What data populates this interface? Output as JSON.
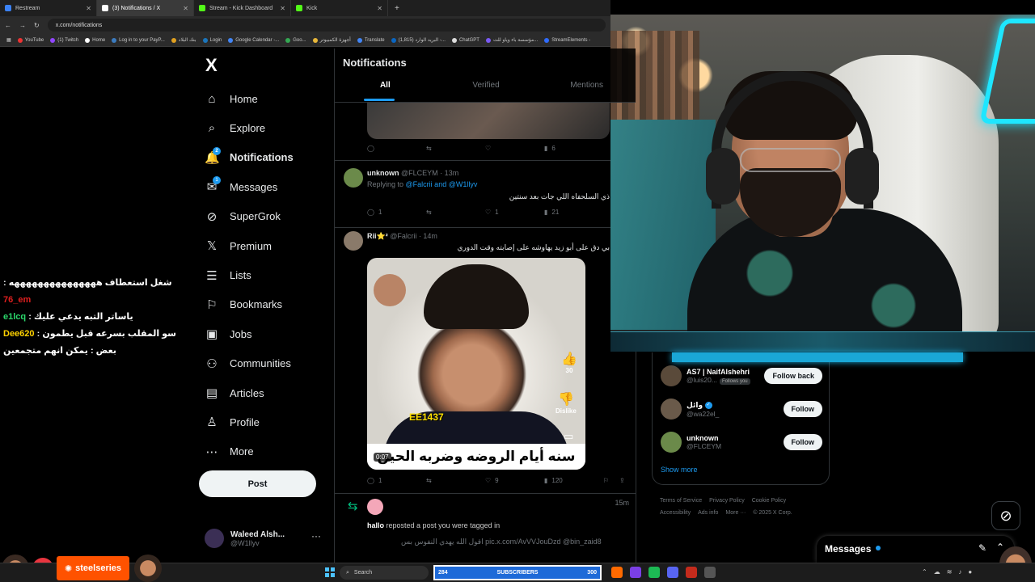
{
  "browser": {
    "tabs": [
      {
        "title": "Restream",
        "color": "#3b82f6"
      },
      {
        "title": "(3) Notifications / X",
        "color": "#ffffff"
      },
      {
        "title": "Stream - Kick Dashboard",
        "color": "#53fc18"
      },
      {
        "title": "Kick",
        "color": "#53fc18"
      }
    ],
    "url": "x.com/notifications",
    "bookmarks": [
      "YouTube",
      "(1) Twitch",
      "Home",
      "Log in to your PayP...",
      "بنك البلاد",
      "Login",
      "Google Calendar -...",
      "Goo...",
      "أجهزة الكمبيوتر",
      "Translate",
      "(1,815) البريد الوارد -...",
      "ChatGPT",
      "مؤسسة باء وياو للت...",
      "StreamElements -"
    ]
  },
  "chat": [
    {
      "user": "76_em",
      "msg": "شغل استعطاف هههههههههههههههه"
    },
    {
      "user": "e1lcq",
      "msg": "ياساتر التبه يدعي عليك"
    },
    {
      "user": "Dee620",
      "msg": "سو المقلب بسرعه قبل يطمون بعض : يمكن انهم متجمعين"
    }
  ],
  "sidebar": {
    "logo": "X",
    "items": [
      {
        "label": "Home",
        "icon": "⌂",
        "badge": ""
      },
      {
        "label": "Explore",
        "icon": "⌕",
        "badge": ""
      },
      {
        "label": "Notifications",
        "icon": "🔔",
        "badge": "2"
      },
      {
        "label": "Messages",
        "icon": "✉",
        "badge": "1"
      },
      {
        "label": "SuperGrok",
        "icon": "⊘",
        "badge": ""
      },
      {
        "label": "Premium",
        "icon": "𝕏",
        "badge": ""
      },
      {
        "label": "Lists",
        "icon": "☰",
        "badge": ""
      },
      {
        "label": "Bookmarks",
        "icon": "⚐",
        "badge": ""
      },
      {
        "label": "Jobs",
        "icon": "▣",
        "badge": ""
      },
      {
        "label": "Communities",
        "icon": "⚇",
        "badge": ""
      },
      {
        "label": "Articles",
        "icon": "▤",
        "badge": ""
      },
      {
        "label": "Profile",
        "icon": "♙",
        "badge": ""
      },
      {
        "label": "More",
        "icon": "⋯",
        "badge": ""
      }
    ],
    "post_label": "Post",
    "account": {
      "name": "Waleed Alsh...",
      "handle": "@W1llyv"
    }
  },
  "feed": {
    "title": "Notifications",
    "tabs": [
      "All",
      "Verified",
      "Mentions"
    ],
    "top_actions": {
      "views": "6"
    },
    "post1": {
      "name": "unknown",
      "handle": "@FLCEYM",
      "time": "· 13m",
      "replying_prefix": "Replying to",
      "replying_to": "@Falcrii and @W1llyv",
      "text": "ذي السلحفاه اللي جات بعد سنتين",
      "replies": "1",
      "likes": "1",
      "views": "21"
    },
    "post2": {
      "name": "Rii⭐²",
      "handle": "@Falcrii",
      "time": "· 14m",
      "text": "بي دق على أبو زيد يهاوشه على إصابته وقت الدوري",
      "video_caption": "سنه أيام الروضه وضربه الحين",
      "video_duration": "0:07",
      "overlay_like_count": "30",
      "overlay_dislike": "Dislike",
      "overlay_tag": "EE1437",
      "replies": "1",
      "likes": "9",
      "views": "120"
    },
    "repost": {
      "time": "15m",
      "user": "hallo",
      "action": "reposted a post you were tagged in",
      "quote": "اقول الله يهدي النفوس بس pic.x.com/AvVVJouDzd @bin_zaid8"
    }
  },
  "who_to_follow": [
    {
      "name": "AS7 | NaifAlshehri",
      "handle": "@luis20...",
      "follows_you": "Follows you",
      "button": "Follow back",
      "verified": false
    },
    {
      "name": "وائل",
      "handle": "@wa22el_",
      "follows_you": "",
      "button": "Follow",
      "verified": true
    },
    {
      "name": "unknown",
      "handle": "@FLCEYM",
      "follows_you": "",
      "button": "Follow",
      "verified": false
    }
  ],
  "show_more": "Show more",
  "footer": [
    "Terms of Service",
    "Privacy Policy",
    "Cookie Policy",
    "Accessibility",
    "Ads info",
    "More ···",
    "© 2025 X Corp."
  ],
  "messages_drawer": {
    "title": "Messages"
  },
  "taskbar": {
    "search": "Search",
    "subs_left": "284",
    "subs_label": "SUBSCRIBERS",
    "subs_right": "300",
    "brand": "steelseries"
  },
  "colors": {
    "accent": "#1d9bf0",
    "repost": "#00ba7c",
    "bg": "#000000"
  }
}
